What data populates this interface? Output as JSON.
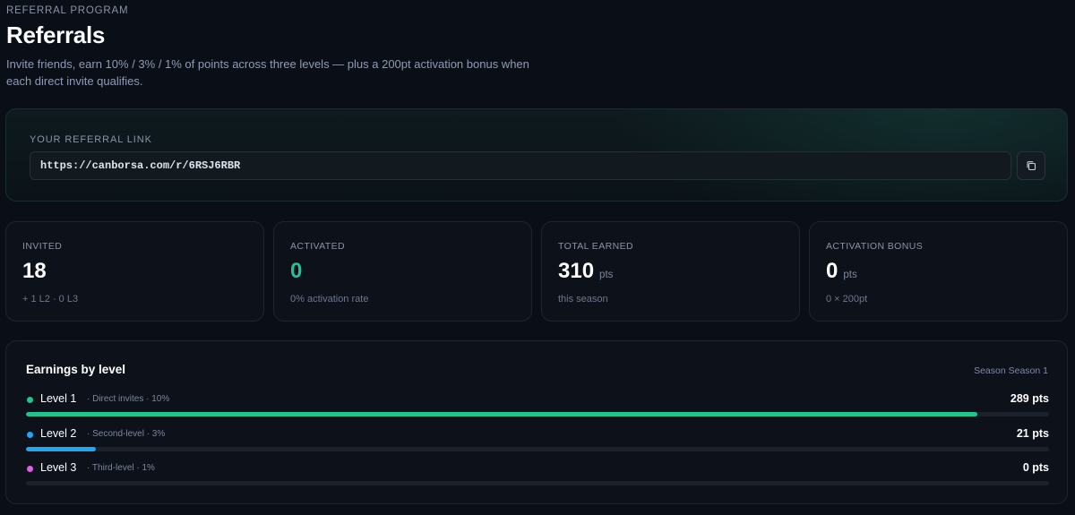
{
  "header": {
    "eyebrow": "REFERRAL PROGRAM",
    "title": "Referrals",
    "subtitle": "Invite friends, earn 10% / 3% / 1% of points across three levels — plus a 200pt activation bonus when each direct invite qualifies."
  },
  "referral_link": {
    "label": "YOUR REFERRAL LINK",
    "url": "https://canborsa.com/r/6RSJ6RBR",
    "copy_icon": "copy-icon"
  },
  "stats": [
    {
      "label": "INVITED",
      "value": "18",
      "unit": "",
      "sub": "+ 1 L2 · 0 L3"
    },
    {
      "label": "ACTIVATED",
      "value": "0",
      "unit": "",
      "sub": "0% activation rate",
      "accent": "#25c08f"
    },
    {
      "label": "TOTAL EARNED",
      "value": "310",
      "unit": "pts",
      "sub": "this season"
    },
    {
      "label": "ACTIVATION BONUS",
      "value": "0",
      "unit": "pts",
      "sub": "0 × 200pt"
    }
  ],
  "earnings": {
    "title": "Earnings by level",
    "season": "Season Season 1",
    "levels": [
      {
        "name": "Level 1",
        "desc": "· Direct invites · 10%",
        "pts": "289 pts",
        "fraction": 0.93,
        "color": "#1fc48f"
      },
      {
        "name": "Level 2",
        "desc": "· Second-level · 3%",
        "pts": "21 pts",
        "fraction": 0.068,
        "color": "#22a6f0"
      },
      {
        "name": "Level 3",
        "desc": "· Third-level · 1%",
        "pts": "0 pts",
        "fraction": 0,
        "color": "#e05fe8"
      }
    ]
  }
}
